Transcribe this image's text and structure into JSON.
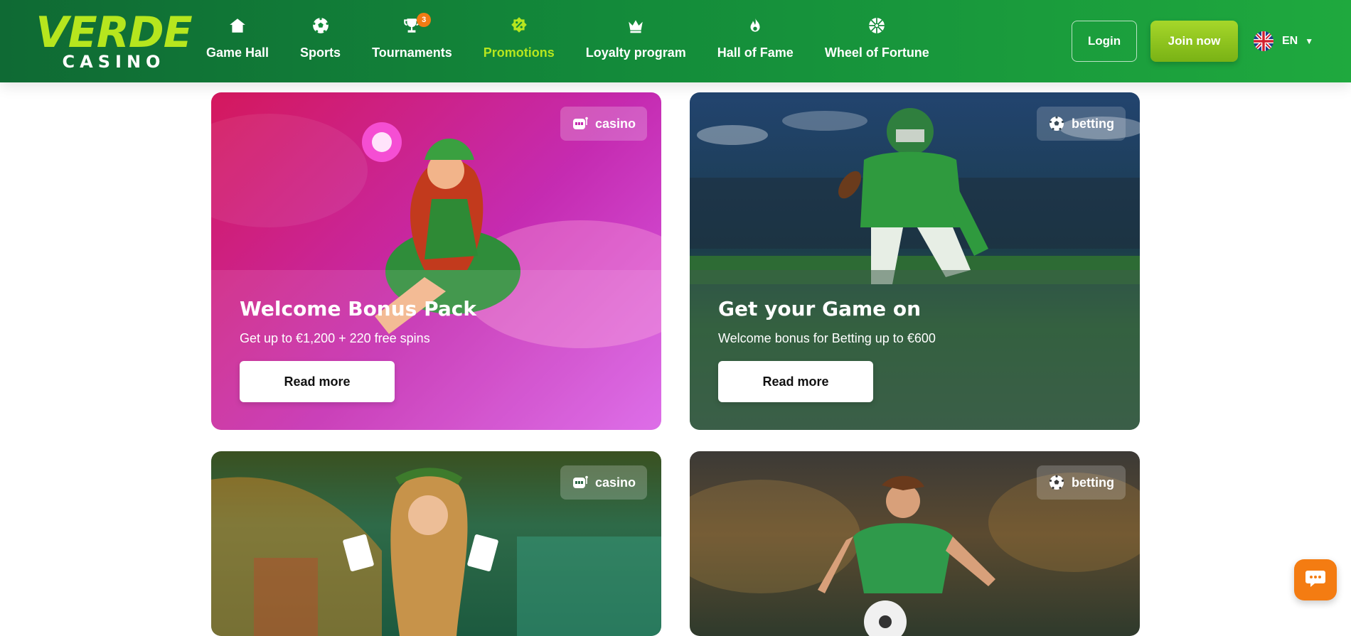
{
  "brand": {
    "top": "VERDE",
    "bottom": "CASINO"
  },
  "nav": [
    {
      "label": "Game Hall",
      "icon": "home-icon"
    },
    {
      "label": "Sports",
      "icon": "soccer-ball-icon"
    },
    {
      "label": "Tournaments",
      "icon": "trophy-icon",
      "badge": "3"
    },
    {
      "label": "Promotions",
      "icon": "percent-badge-icon",
      "active": true
    },
    {
      "label": "Loyalty program",
      "icon": "crown-icon"
    },
    {
      "label": "Hall of Fame",
      "icon": "flame-icon"
    },
    {
      "label": "Wheel of Fortune",
      "icon": "wheel-icon"
    }
  ],
  "auth": {
    "login": "Login",
    "join": "Join now"
  },
  "language": {
    "code": "EN",
    "flag": "uk-flag-icon"
  },
  "promos": [
    {
      "tag": "casino",
      "title": "Welcome Bonus Pack",
      "subtitle": "Get up to €1,200 + 220 free spins",
      "button": "Read more"
    },
    {
      "tag": "betting",
      "title": "Get your Game on",
      "subtitle": "Welcome bonus for Betting up to €600",
      "button": "Read more"
    },
    {
      "tag": "casino"
    },
    {
      "tag": "betting"
    }
  ],
  "colors": {
    "header_start": "#0f6a34",
    "header_end": "#1fa93e",
    "accent": "#b6e61e",
    "join": "#8cc41f",
    "chat": "#f47c12"
  }
}
